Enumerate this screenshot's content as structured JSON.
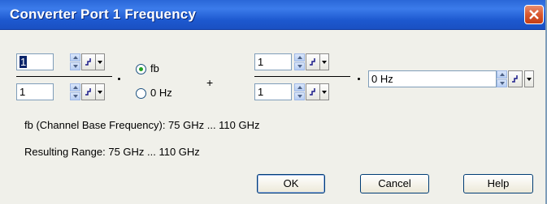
{
  "window": {
    "title": "Converter Port 1 Frequency",
    "close_icon": "close-icon"
  },
  "fraction_left": {
    "numerator": "1",
    "denominator": "1"
  },
  "radio": {
    "fb_label": "fb",
    "zero_label": "0 Hz",
    "selected": "fb"
  },
  "plus": "+",
  "fraction_right": {
    "numerator": "1",
    "denominator": "1"
  },
  "offset": {
    "value": "0 Hz"
  },
  "info": {
    "channel_base": "fb (Channel Base Frequency): 75 GHz ... 110 GHz",
    "resulting_range": "Resulting Range: 75 GHz ... 110 GHz"
  },
  "buttons": {
    "ok": "OK",
    "cancel": "Cancel",
    "help": "Help"
  },
  "colors": {
    "titlebar": "#2a67d8",
    "dialog_bg": "#f0f0ea",
    "radio_dot": "#21a121"
  }
}
